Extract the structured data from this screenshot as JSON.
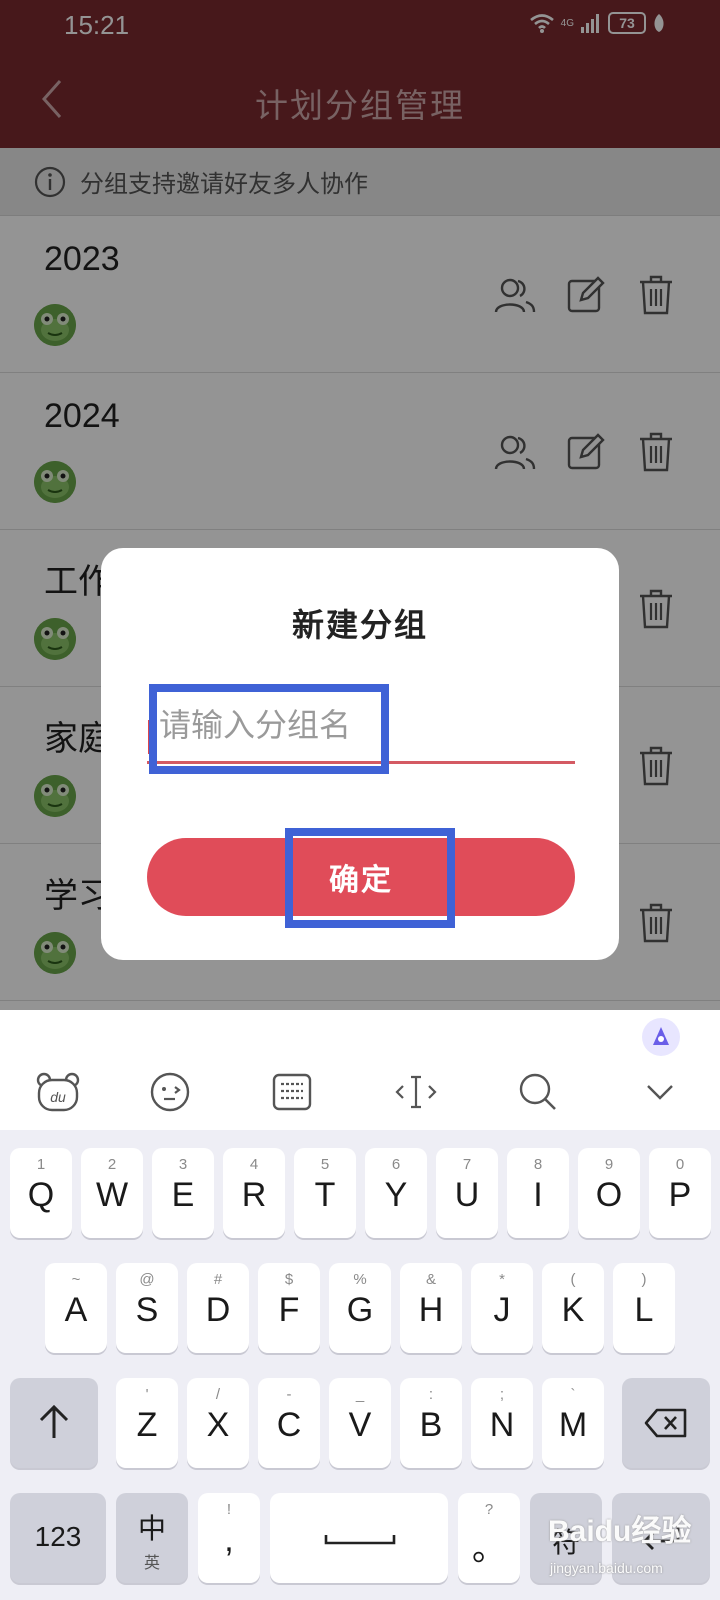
{
  "status_bar": {
    "time": "15:21",
    "network": "4G",
    "battery": "73"
  },
  "header": {
    "title": "计划分组管理"
  },
  "tip": {
    "text": "分组支持邀请好友多人协作"
  },
  "groups": [
    {
      "name": "2023"
    },
    {
      "name": "2024"
    },
    {
      "name": "工作"
    },
    {
      "name": "家庭"
    },
    {
      "name": "学习"
    }
  ],
  "dialog": {
    "title": "新建分组",
    "input_placeholder": "请输入分组名",
    "input_value": "",
    "confirm_label": "确定"
  },
  "colors": {
    "app_bar": "#7a2a30",
    "accent": "#e04c59",
    "annotation": "#3f62d6"
  },
  "keyboard": {
    "toolbar_icons": [
      "du-bear-icon",
      "emoji-icon",
      "keyboard-layout-icon",
      "cursor-move-icon",
      "search-icon",
      "collapse-chevron-icon"
    ],
    "row1": [
      {
        "main": "Q",
        "sub": "1"
      },
      {
        "main": "W",
        "sub": "2"
      },
      {
        "main": "E",
        "sub": "3"
      },
      {
        "main": "R",
        "sub": "4"
      },
      {
        "main": "T",
        "sub": "5"
      },
      {
        "main": "Y",
        "sub": "6"
      },
      {
        "main": "U",
        "sub": "7"
      },
      {
        "main": "I",
        "sub": "8"
      },
      {
        "main": "O",
        "sub": "9"
      },
      {
        "main": "P",
        "sub": "0"
      }
    ],
    "row2": [
      {
        "main": "A",
        "sub": "~"
      },
      {
        "main": "S",
        "sub": "@"
      },
      {
        "main": "D",
        "sub": "#"
      },
      {
        "main": "F",
        "sub": "$"
      },
      {
        "main": "G",
        "sub": "%"
      },
      {
        "main": "H",
        "sub": "&"
      },
      {
        "main": "J",
        "sub": "*"
      },
      {
        "main": "K",
        "sub": "("
      },
      {
        "main": "L",
        "sub": ")"
      }
    ],
    "row3": [
      {
        "main": "Z",
        "sub": "'"
      },
      {
        "main": "X",
        "sub": "/"
      },
      {
        "main": "C",
        "sub": "-"
      },
      {
        "main": "V",
        "sub": "_"
      },
      {
        "main": "B",
        "sub": ":"
      },
      {
        "main": "N",
        "sub": ";"
      },
      {
        "main": "M",
        "sub": "`"
      }
    ],
    "numbers_key": "123",
    "lang_key_main": "中",
    "lang_key_sub": "英",
    "comma_key_main": ",",
    "comma_key_sub": "!",
    "period_key_main": "。",
    "period_key_sub": "?",
    "symbols_key": "符"
  },
  "watermark": {
    "logo": "Baidu经验",
    "url": "jingyan.baidu.com"
  }
}
